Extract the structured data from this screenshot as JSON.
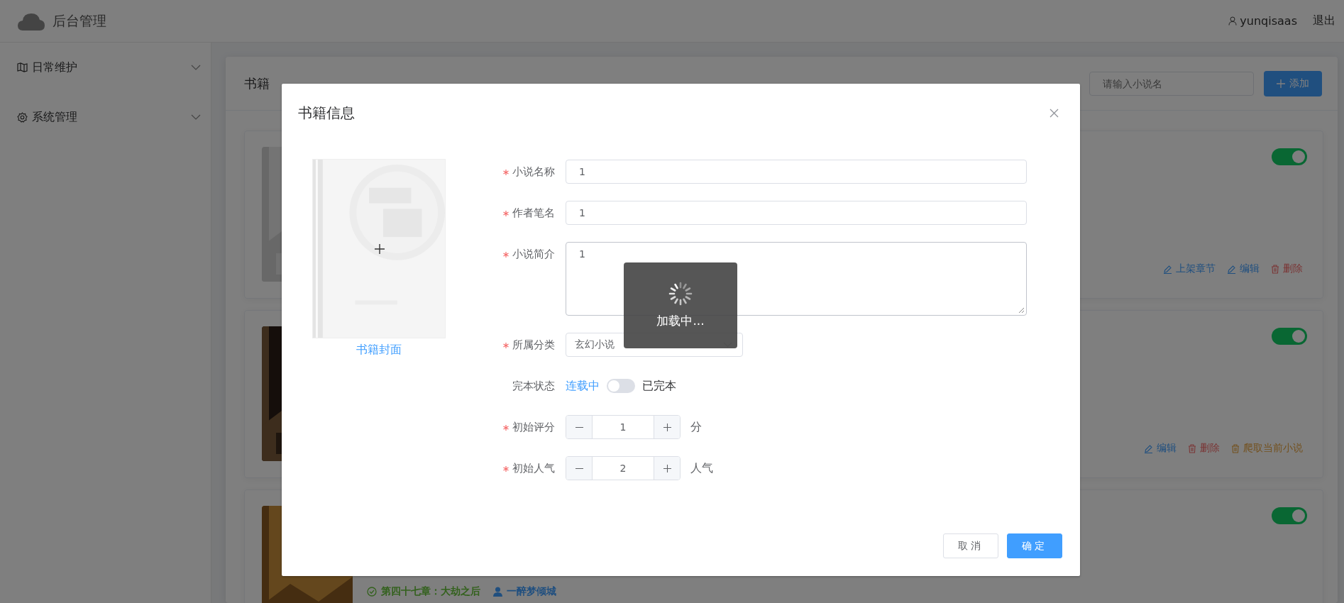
{
  "header": {
    "brand": "后台管理",
    "user": "yunqisaas",
    "logout": "退出"
  },
  "sidebar": {
    "items": [
      {
        "label": "日常维护"
      },
      {
        "label": "系统管理"
      }
    ]
  },
  "main": {
    "title": "书籍",
    "search": {
      "placeholder": "请输入小说名"
    },
    "add_button": "添加"
  },
  "books": [
    {
      "on": true,
      "actions": [
        {
          "label": "上架章节",
          "kind": "edit"
        },
        {
          "label": "编辑",
          "kind": "edit"
        },
        {
          "label": "删除",
          "kind": "delete"
        }
      ]
    },
    {
      "on": true,
      "actions": [
        {
          "label": "编辑",
          "kind": "edit"
        },
        {
          "label": "删除",
          "kind": "delete"
        },
        {
          "label": "爬取当前小说",
          "kind": "crawl"
        }
      ]
    },
    {
      "on": true,
      "chapter": "第四十七章：大劫之后",
      "author": "一醉梦倾城"
    }
  ],
  "dialog": {
    "title": "书籍信息",
    "cover_label": "书籍封面",
    "fields": [
      {
        "label": "小说名称",
        "required": true,
        "kind": "input",
        "value": "1"
      },
      {
        "label": "作者笔名",
        "required": true,
        "kind": "input",
        "value": "1"
      },
      {
        "label": "小说简介",
        "required": true,
        "kind": "textarea",
        "value": "1"
      },
      {
        "label": "所属分类",
        "required": true,
        "kind": "select",
        "value": "玄幻小说"
      },
      {
        "label": "完本状态",
        "required": false,
        "kind": "switch",
        "off_label": "连载中",
        "on_label": "已完本",
        "on": false
      },
      {
        "label": "初始评分",
        "required": true,
        "kind": "number",
        "value": "1",
        "unit": "分"
      },
      {
        "label": "初始人气",
        "required": true,
        "kind": "number",
        "value": "2",
        "unit": "人气"
      }
    ],
    "loading": "加载中...",
    "buttons": [
      {
        "label": "取消",
        "kind": "default"
      },
      {
        "label": "确定",
        "kind": "primary"
      }
    ]
  }
}
